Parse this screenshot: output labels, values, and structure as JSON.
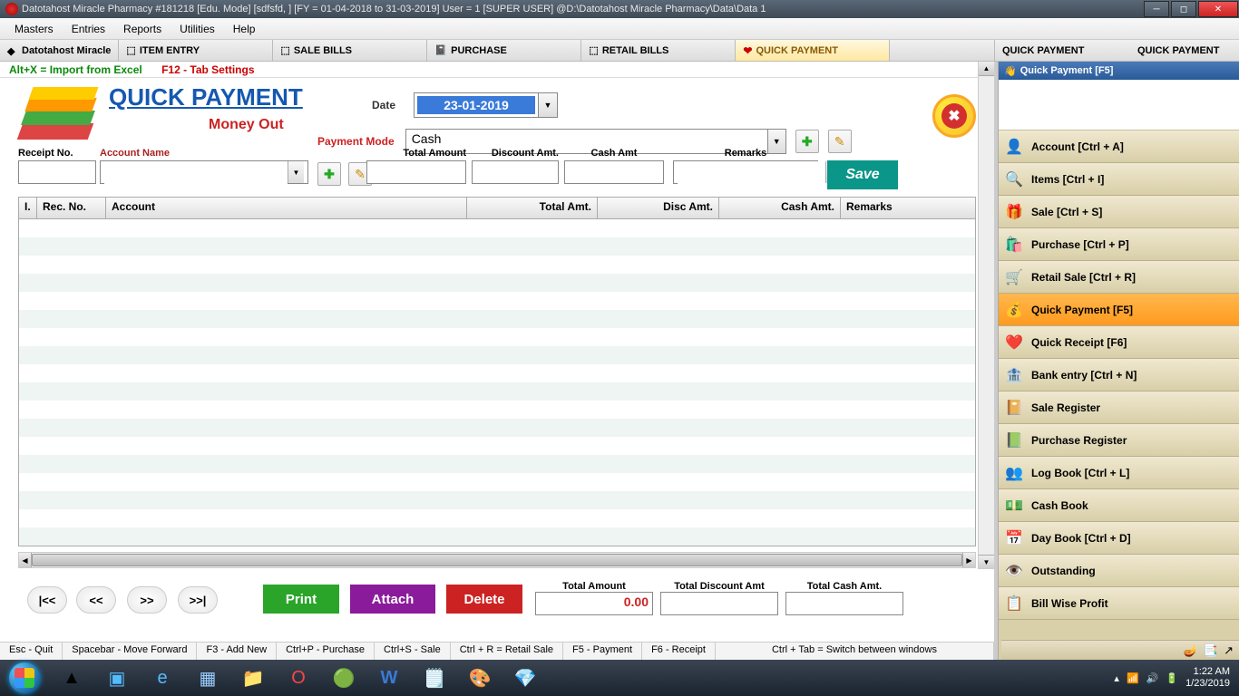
{
  "title": "Datotahost Miracle Pharmacy #181218  [Edu. Mode]  [sdfsfd, ] [FY = 01-04-2018 to 31-03-2019] User = 1 [SUPER USER]  @D:\\Datotahost Miracle Pharmacy\\Data\\Data 1",
  "menubar": [
    "Masters",
    "Entries",
    "Reports",
    "Utilities",
    "Help"
  ],
  "tabs": {
    "left": [
      "Datotahost Miracle",
      "ITEM ENTRY",
      "SALE BILLS",
      "PURCHASE",
      "RETAIL BILLS",
      "QUICK PAYMENT"
    ],
    "right": [
      "QUICK PAYMENT",
      "QUICK PAYMENT"
    ]
  },
  "shortcuts": {
    "altx_label": "Alt+X =",
    "altx_text": "  Import from Excel",
    "f12_text": "F12 - Tab Settings"
  },
  "page": {
    "title": "QUICK PAYMENT",
    "subtitle": "Money Out",
    "date_label": "Date",
    "date_value": "23-01-2019",
    "mode_label": "Payment Mode",
    "mode_value": "Cash"
  },
  "entry": {
    "receipt_label": "Receipt No.",
    "account_label": "Account Name",
    "totalamt_label": "Total Amount",
    "discamt_label": "Discount Amt.",
    "cashamt_label": "Cash Amt",
    "remarks_label": "Remarks",
    "save_label": "Save"
  },
  "grid": {
    "headers": [
      "I.",
      "Rec. No.",
      "Account",
      "Total Amt.",
      "Disc Amt.",
      "Cash Amt.",
      "Remarks"
    ]
  },
  "actions": {
    "first": "|<<",
    "prev": "<<",
    "next": ">>",
    "last": ">>|",
    "print": "Print",
    "attach": "Attach",
    "delete": "Delete"
  },
  "totals": {
    "totalamt_label": "Total Amount",
    "totalamt_value": "0.00",
    "totaldisc_label": "Total Discount Amt",
    "totaldisc_value": "",
    "totalcash_label": "Total Cash Amt.",
    "totalcash_value": ""
  },
  "statusbar": [
    "Esc - Quit",
    "Spacebar - Move Forward",
    "F3 - Add New",
    "Ctrl+P - Purchase",
    "Ctrl+S - Sale",
    "Ctrl + R = Retail Sale",
    "F5 - Payment",
    "F6 - Receipt",
    "Ctrl + Tab = Switch between windows"
  ],
  "sidepanel": {
    "header": "Quick Payment [F5]",
    "items": [
      {
        "label": "Account [Ctrl + A]",
        "icon": "👤"
      },
      {
        "label": "Items [Ctrl + I]",
        "icon": "🔍"
      },
      {
        "label": "Sale [Ctrl + S]",
        "icon": "🎁"
      },
      {
        "label": "Purchase [Ctrl + P]",
        "icon": "🛍️"
      },
      {
        "label": "Retail Sale [Ctrl + R]",
        "icon": "🛒"
      },
      {
        "label": "Quick Payment [F5]",
        "icon": "💰",
        "active": true
      },
      {
        "label": "Quick Receipt [F6]",
        "icon": "❤️"
      },
      {
        "label": "Bank entry [Ctrl + N]",
        "icon": "🏦"
      },
      {
        "label": "Sale Register",
        "icon": "📔"
      },
      {
        "label": "Purchase Register",
        "icon": "📗"
      },
      {
        "label": "Log Book [Ctrl + L]",
        "icon": "👥"
      },
      {
        "label": "Cash Book",
        "icon": "💵"
      },
      {
        "label": "Day Book [Ctrl + D]",
        "icon": "📅"
      },
      {
        "label": "Outstanding",
        "icon": "👁️"
      },
      {
        "label": "Bill Wise Profit",
        "icon": "📋"
      }
    ]
  },
  "tray": {
    "time": "1:22 AM",
    "date": "1/23/2019"
  }
}
